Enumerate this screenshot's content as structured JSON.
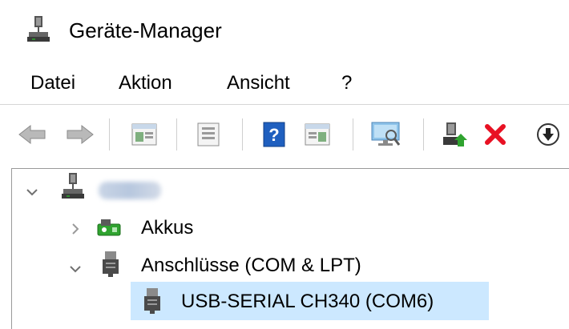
{
  "window": {
    "title": "Geräte-Manager"
  },
  "menu": [
    "Datei",
    "Aktion",
    "Ansicht",
    "?"
  ],
  "toolbar": {
    "icons": [
      "back-arrow-icon",
      "forward-arrow-icon",
      "show-hide-console-tree-icon",
      "properties-icon",
      "help-icon",
      "action-pane-icon",
      "scan-hardware-icon",
      "update-driver-icon",
      "uninstall-device-icon",
      "disable-device-icon"
    ],
    "help_label": "?"
  },
  "tree": {
    "root": {
      "expanded": true,
      "blurred": true
    },
    "items": [
      {
        "label": "Akkus",
        "expanded": false,
        "icon": "battery-icon"
      },
      {
        "label": "Anschlüsse (COM & LPT)",
        "expanded": true,
        "icon": "port-icon"
      },
      {
        "label": "USB-SERIAL CH340 (COM6)",
        "selected": true,
        "icon": "port-icon"
      }
    ]
  },
  "colors": {
    "selection": "#cce8ff",
    "delete_red": "#e81123",
    "help_blue": "#1f5fbf"
  }
}
